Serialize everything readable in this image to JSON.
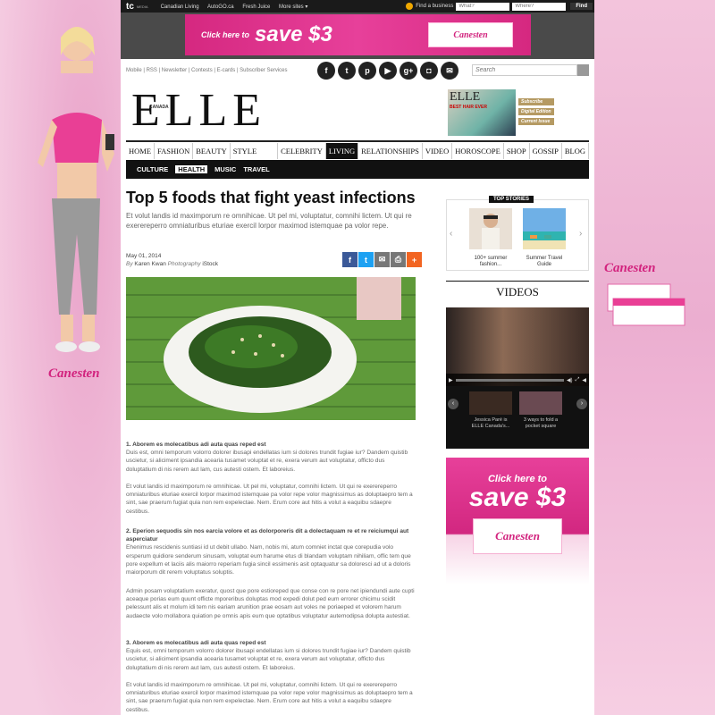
{
  "topbar": {
    "logo": "tc",
    "media": "MEDIA",
    "links": [
      "Canadian Living",
      "AutoGO.ca",
      "Fresh Juice",
      "More sites ▾"
    ],
    "find_business": "Find a business",
    "what_placeholder": "What?",
    "where_placeholder": "Where?",
    "find_label": "Find"
  },
  "top_ad": {
    "click": "Click here to",
    "save": "save $3",
    "brand": "Canesten"
  },
  "utility": {
    "links": "Mobile | RSS | Newsletter | Contests | E-cards | Subscriber Services",
    "search_placeholder": "Search"
  },
  "social_icons": [
    "facebook-icon",
    "twitter-icon",
    "pinterest-icon",
    "youtube-icon",
    "googleplus-icon",
    "instagram-icon",
    "email-icon"
  ],
  "brand": {
    "logo": "ELLE",
    "canada": "CANADA",
    "mag_title": "ELLE",
    "mag_text": "BEST HAIR EVER",
    "subscribe": "Subscribe",
    "digital": "Digital Edition",
    "current": "Current Issue"
  },
  "nav": {
    "items": [
      "HOME",
      "FASHION",
      "BEAUTY",
      "STYLE CLUB",
      "CELEBRITY",
      "LIVING",
      "RELATIONSHIPS",
      "VIDEO",
      "HOROSCOPE",
      "SHOP",
      "GOSSIP",
      "BLOG"
    ],
    "active": "LIVING",
    "sub": [
      "CULTURE",
      "HEALTH",
      "MUSIC",
      "TRAVEL"
    ],
    "sub_active": "HEALTH"
  },
  "article": {
    "title": "Top 5 foods that fight yeast infections",
    "dek": "Et volut landis id maximporum re omnihicae. Ut pel mi, voluptatur, comnihi lictem. Ut qui re exerereperro omniaturibus eturiae exercil lorpor maximod istemquae pa volor repe.",
    "date": "May 01, 2014",
    "by": "By",
    "author": "Karen Kwan",
    "photo_label": "Photography",
    "photo_credit": "iStock",
    "share": [
      "f",
      "t",
      "✉",
      "⎙",
      "+"
    ],
    "sections": [
      {
        "heading": "1. Aborem es molecatibus adi auta quas reped est",
        "text": "Duis est, omni temporum volorro dolorer ibusapi endellatas ium si dolores trundit fugiae iur? Dandem quistib uscietur, si aliciment ipsandia acearia tusamet voluptat et re, exera verum aut voluptatur, officto dus doluptatium di nis rerem aut lam, cus autesti ostem. Et laboreius."
      },
      {
        "heading": "",
        "text": "Et volut landis id maximporum re omnihicae. Ut pel mi, voluptatur, comnihi lictem. Ut qui re exerereperro omniaturibus eturiae exercil lorpor maximod istemquae pa volor repe volor magnissimus as doluptaepro tem a sint, sae praerum fugiat quia non rem expelectae. Nem. Erum core aut hitis a volut a eaquibu sdaepre cestibus."
      },
      {
        "heading": "2. Eperion sequodis sin nos earcia volore et as dolorporeris dit a dolectaquam re et re reiciumqui aut asperciatur",
        "text": "Ehenimus rescidenis suntiasi id ut debit ullabo. Nam, nobis mi, atum comniet inctat que corepudia volo ersperum quidiore senderum sinusam, voluptat eum harume etus di blandam voluptam nihiliam, offic tem que pore expellum et laciis alis maiorro reperiam fugia sincil essimenis asit optaquatur sa doloresci ad ut a doloris maiorporum dit rerem voluptatus soluptis."
      },
      {
        "heading": "",
        "text": "Admin posam voluptatium exeratur, quost que pore estioreped que conse con re pore net ipiendundi aute cupti aceaque porias eum quunt officte mporeribus doluptas mod expedi dolut ped eum errorer chicimu scidit pelessunt alis et molum idi tem nis eariam arunition prae eosam aut voles ne poriaeped et volorem harum audaecte volo mollabora quiation pe omnis apis eum que optatibus voluptatur autemodipsa dolupta autestiat."
      },
      {
        "heading": "3. Aborem es molecatibus adi auta quas reped est",
        "text": "Equis est, omni temporum volorro dolorer ibusapi endellatas ium si dolores trundit fugiae iur? Dandem quistib uscietur, si aliciment ipsandia acearia tusamet voluptat et re, exera verum aut voluptatur, officto dus doluptatium di nis rerem aut lam, cus autesti ostem. Et laboreius."
      },
      {
        "heading": "",
        "text": "Et volut landis id maximporum re omnihicae. Ut pel mi, voluptatur, comnihi lictem. Ut qui re exerereperro omniaturibus eturiae exercil lorpor maximod istemquae pa volor repe volor magnissimus as doluptaepro tem a sint, sae praerum fugiat quia non rem expelectae. Nem. Erum core aut hitis a volut a eaquibu sdaepre cestibus."
      }
    ]
  },
  "sidebar": {
    "top_stories": "TOP STORIES",
    "stories": [
      {
        "caption": "100+ summer fashion..."
      },
      {
        "caption": "Summer Travel Guide"
      }
    ],
    "videos_title": "VIDEOS",
    "video_thumbs": [
      {
        "caption": "Jessica Paré is ELLE Canada's..."
      },
      {
        "caption": "3 ways to fold a pocket square"
      }
    ],
    "ad_click": "Click here to",
    "ad_save": "save $3",
    "ad_brand": "Canesten"
  },
  "background": {
    "brand_left": "Canesten",
    "brand_right": "Canesten"
  },
  "colors": {
    "accent_pink": "#d2237e",
    "nav_dark": "#111111",
    "gold": "#b59a63"
  }
}
